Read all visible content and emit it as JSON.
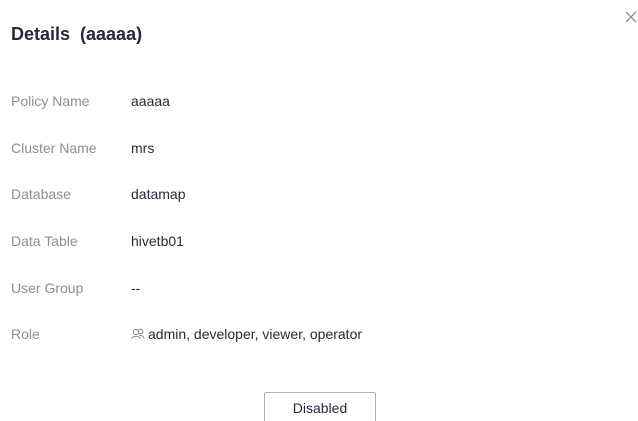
{
  "dialog": {
    "title": "Details  (aaaaa)",
    "close_icon": "close-icon",
    "fields": [
      {
        "label": "Policy Name",
        "value": "aaaaa"
      },
      {
        "label": "Cluster Name",
        "value": "mrs"
      },
      {
        "label": "Database",
        "value": "datamap"
      },
      {
        "label": "Data Table",
        "value": "hivetb01"
      },
      {
        "label": "User Group",
        "value": "--"
      },
      {
        "label": "Role",
        "value": "admin, developer, viewer, operator",
        "icon": "role-group-icon"
      }
    ],
    "button_label": "Disabled"
  }
}
